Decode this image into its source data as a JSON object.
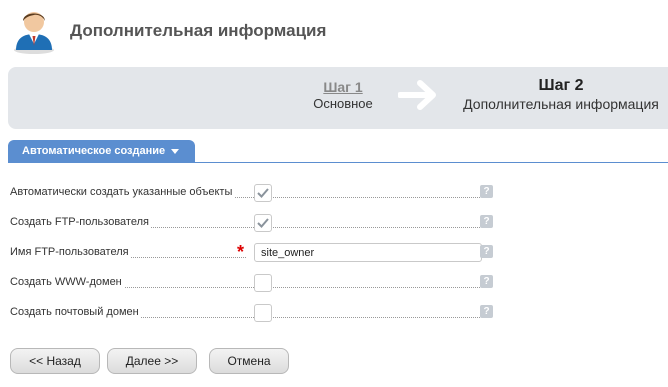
{
  "header": {
    "title": "Дополнительная информация",
    "avatar_icon": "user-avatar-icon"
  },
  "steps": [
    {
      "number": "Шаг 1",
      "name": "Основное"
    },
    {
      "number": "Шаг 2",
      "name": "Дополнительная информация"
    }
  ],
  "tab": {
    "label": "Автоматическое создание"
  },
  "form": {
    "auto_create": {
      "label": "Автоматически создать указанные объекты",
      "checked": true
    },
    "ftp_user": {
      "label": "Создать FTP-пользователя",
      "checked": true
    },
    "ftp_name": {
      "label": "Имя FTP-пользователя",
      "value": "site_owner",
      "required": true
    },
    "www_domain": {
      "label": "Создать WWW-домен",
      "checked": false
    },
    "mail_domain": {
      "label": "Создать почтовый домен",
      "checked": false
    },
    "help_glyph": "?"
  },
  "buttons": {
    "back": "<< Назад",
    "next": "Далее >>",
    "cancel": "Отмена"
  },
  "colors": {
    "tab": "#5b8ed0",
    "steps_bg": "#e3e6ea",
    "required": "#dd0000"
  }
}
